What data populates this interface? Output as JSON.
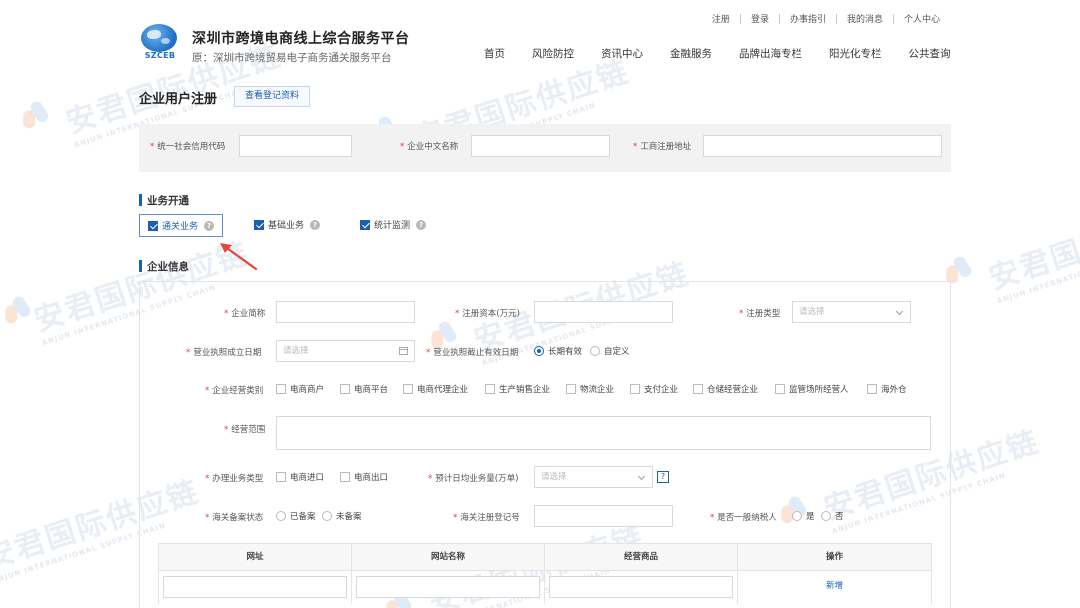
{
  "header": {
    "logo_text": "SZCEB",
    "title": "深圳市跨境电商线上综合服务平台",
    "subtitle": "原：深圳市跨境贸易电子商务通关服务平台",
    "top_links": [
      "注册",
      "登录",
      "办事指引",
      "我的消息",
      "个人中心"
    ],
    "nav": [
      "首页",
      "风险防控",
      "资讯中心",
      "金融服务",
      "品牌出海专栏",
      "阳光化专栏",
      "公共查询"
    ]
  },
  "page": {
    "title": "企业用户注册",
    "view_button": "查看登记资料"
  },
  "registration": {
    "credit_code_label": "统一社会信用代码",
    "company_name_label": "企业中文名称",
    "address_label": "工商注册地址"
  },
  "business": {
    "section_title": "业务开通",
    "items": [
      {
        "label": "通关业务",
        "checked": true,
        "highlighted": true
      },
      {
        "label": "基础业务",
        "checked": true,
        "highlighted": false
      },
      {
        "label": "统计监测",
        "checked": true,
        "highlighted": false
      }
    ]
  },
  "enterprise": {
    "section_title": "企业信息",
    "short_name_label": "企业简称",
    "capital_label": "注册资本(万元)",
    "reg_type_label": "注册类型",
    "reg_type_placeholder": "请选择",
    "license_date_label": "营业执照成立日期",
    "license_date_placeholder": "请选择",
    "license_expiry_label": "营业执照截止有效日期",
    "expiry_options": [
      {
        "label": "长期有效",
        "selected": true
      },
      {
        "label": "自定义",
        "selected": false
      }
    ],
    "category_label": "企业经营类别",
    "categories": [
      "电商商户",
      "电商平台",
      "电商代理企业",
      "生产销售企业",
      "物流企业",
      "支付企业",
      "仓储经营企业",
      "监管场所经营人",
      "海外仓"
    ],
    "scope_label": "经营范围",
    "biz_type_label": "办理业务类型",
    "biz_types": [
      "电商进口",
      "电商出口"
    ],
    "daily_volume_label": "预计日均业务量(万单)",
    "daily_volume_placeholder": "请选择",
    "help_glyph": "?",
    "customs_status_label": "海关备案状态",
    "customs_status_options": [
      {
        "label": "已备案",
        "selected": false
      },
      {
        "label": "未备案",
        "selected": false
      }
    ],
    "customs_reg_no_label": "海关注册登记号",
    "taxpayer_label": "是否一般纳税人",
    "taxpayer_options": [
      {
        "label": "是",
        "selected": false
      },
      {
        "label": "否",
        "selected": false
      }
    ]
  },
  "website_table": {
    "columns": [
      "网址",
      "网站名称",
      "经营商品",
      "操作"
    ],
    "add_label": "新增"
  },
  "watermark": {
    "text": "安君国际供应链",
    "subtext": "ANJUN INTERNATIONAL SUPPLY CHAIN"
  },
  "colors": {
    "accent": "#1a5fb4",
    "required": "#e23a3a",
    "arrow": "#e8453c"
  }
}
